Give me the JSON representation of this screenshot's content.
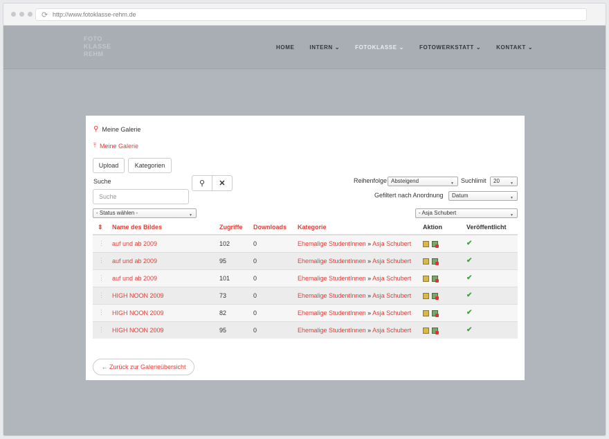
{
  "browser": {
    "url": "http://www.fotoklasse-rehm.de"
  },
  "header": {
    "logo_lines": [
      "FOTO",
      "KLASSE",
      "REHM"
    ],
    "nav": [
      {
        "label": "HOME",
        "dropdown": false,
        "active": false
      },
      {
        "label": "INTERN",
        "dropdown": true,
        "active": false
      },
      {
        "label": "FOTOKLASSE",
        "dropdown": true,
        "active": true
      },
      {
        "label": "FOTOWERKSTATT",
        "dropdown": true,
        "active": false
      },
      {
        "label": "KONTAKT",
        "dropdown": true,
        "active": false
      }
    ]
  },
  "gallery": {
    "title": "Meine Galerie",
    "upload_link": "Meine Galerie",
    "buttons": {
      "upload": "Upload",
      "categories": "Kategorien"
    },
    "search": {
      "label": "Suche",
      "placeholder": "Suche"
    },
    "order": {
      "label": "Reihenfolge",
      "value": "Absteigend"
    },
    "limit": {
      "label": "Suchlimit",
      "value": "20"
    },
    "filter": {
      "label": "Gefiltert nach Anordnung",
      "value": "Datum"
    },
    "status_select": "- Status wählen -",
    "user_select": "- Asja Schubert",
    "columns": {
      "name": "Name des Bildes",
      "views": "Zugriffe",
      "downloads": "Downloads",
      "category": "Kategorie",
      "action": "Aktion",
      "published": "Veröffentlicht"
    },
    "rows": [
      {
        "name": "auf und ab 2009",
        "views": "102",
        "downloads": "0",
        "cat": "Ehemalige StudentInnen",
        "sep": "»",
        "sub": "Asja Schubert"
      },
      {
        "name": "auf und ab 2009",
        "views": "95",
        "downloads": "0",
        "cat": "Ehemalige StudentInnen",
        "sep": "»",
        "sub": "Asja Schubert"
      },
      {
        "name": "auf und ab 2009",
        "views": "101",
        "downloads": "0",
        "cat": "Ehemalige StudentInnen",
        "sep": "»",
        "sub": "Asja Schubert"
      },
      {
        "name": "HIGH NOON 2009",
        "views": "73",
        "downloads": "0",
        "cat": "Ehemalige StudentInnen",
        "sep": "»",
        "sub": "Asja Schubert"
      },
      {
        "name": "HIGH NOON 2009",
        "views": "82",
        "downloads": "0",
        "cat": "Ehemalige StudentInnen",
        "sep": "»",
        "sub": "Asja Schubert"
      },
      {
        "name": "HIGH NOON 2009",
        "views": "95",
        "downloads": "0",
        "cat": "Ehemalige StudentInnen",
        "sep": "»",
        "sub": "Asja Schubert"
      }
    ],
    "back_button": "← Zurück zur Galerieübersicht"
  },
  "colors": {
    "accent": "#e0413a",
    "header_bg": "#a9adb4",
    "page_bg": "#b1b5bc"
  }
}
